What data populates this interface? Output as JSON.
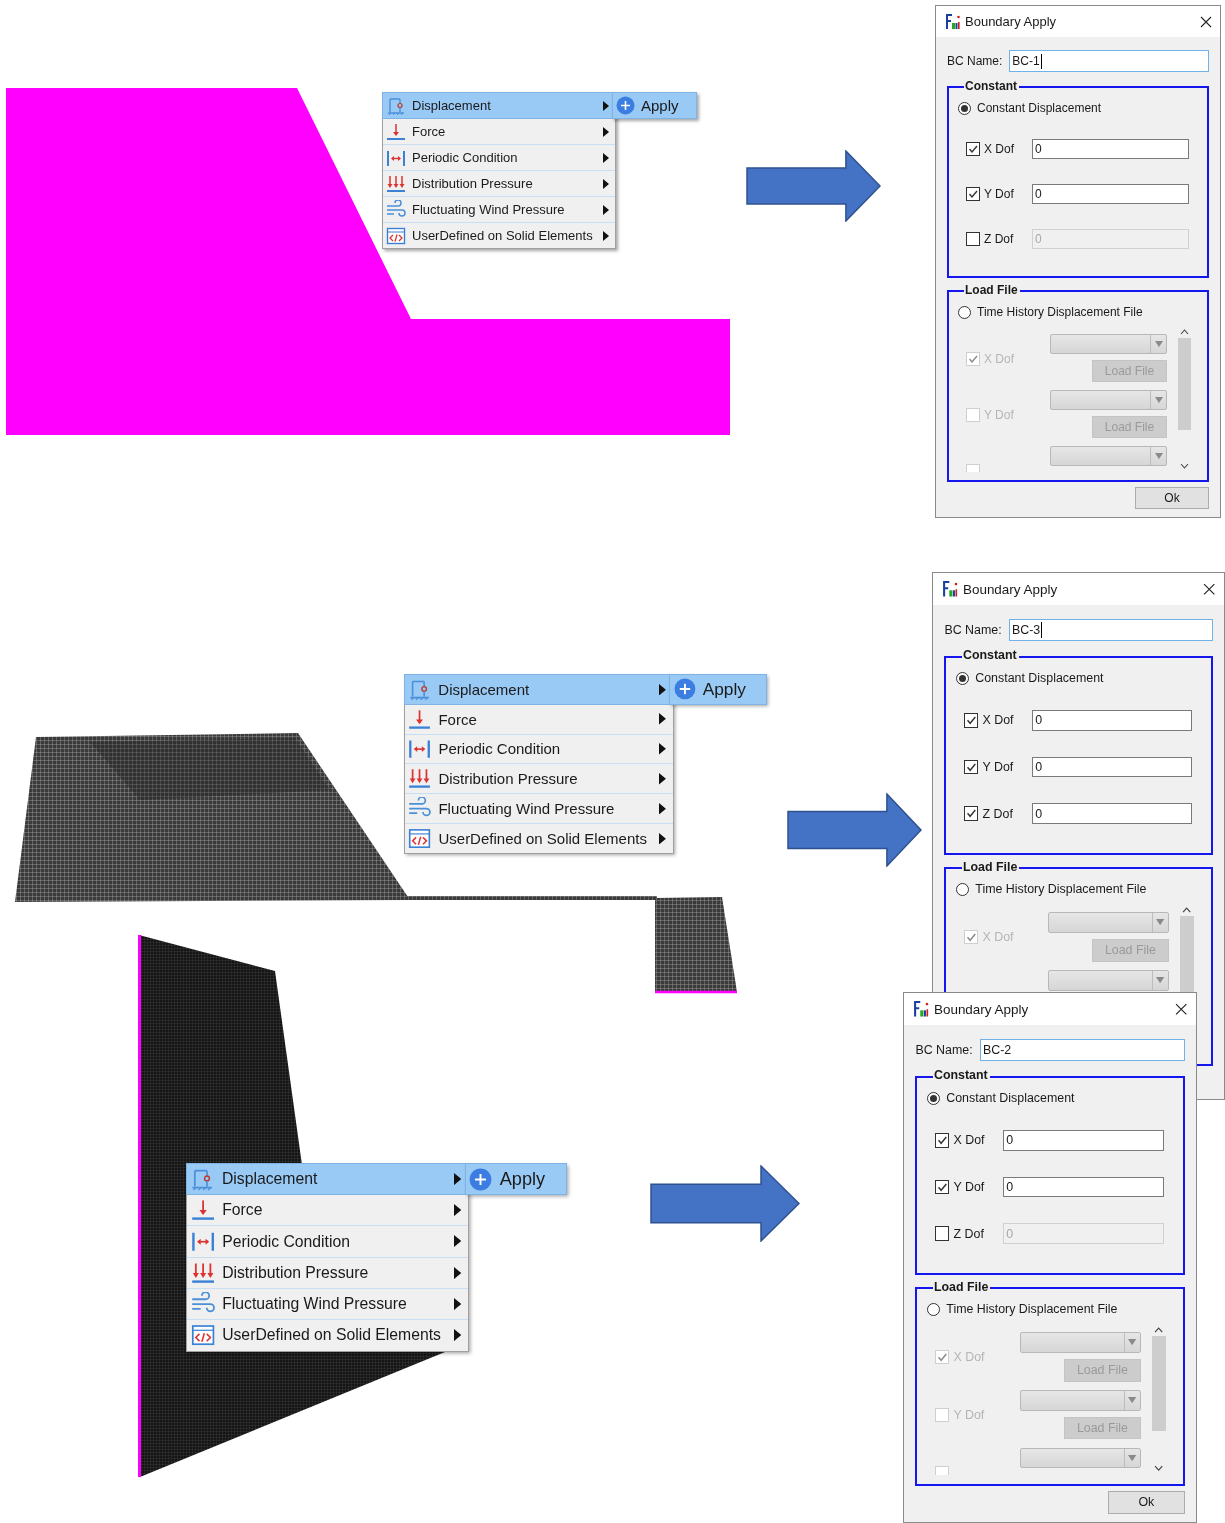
{
  "scenes": [
    {
      "model": {
        "kind": "flat"
      },
      "menu": {
        "items": [
          {
            "label": "Displacement",
            "selected": true
          },
          {
            "label": "Force",
            "selected": false
          },
          {
            "label": "Periodic Condition",
            "selected": false
          },
          {
            "label": "Distribution Pressure",
            "selected": false
          },
          {
            "label": "Fluctuating Wind Pressure",
            "selected": false
          },
          {
            "label": "UserDefined on Solid Elements",
            "selected": false
          }
        ],
        "submenu": {
          "label": "Apply"
        }
      },
      "dialog": {
        "title": "Boundary Apply",
        "name_label": "BC Name:",
        "name_value": "BC-1",
        "focused": true,
        "constant": {
          "title": "Constant",
          "option": {
            "label": "Constant Displacement",
            "selected": true
          },
          "dofs": [
            {
              "label": "X Dof",
              "checked": true,
              "value": "0"
            },
            {
              "label": "Y Dof",
              "checked": true,
              "value": "0"
            },
            {
              "label": "Z Dof",
              "checked": false,
              "value": "0"
            }
          ]
        },
        "load_file": {
          "title": "Load File",
          "option": {
            "label": "Time History Displacement File",
            "selected": false
          },
          "rows": [
            {
              "label": "X Dof",
              "checked": true,
              "button": "Load File"
            },
            {
              "label": "Y Dof",
              "checked": false,
              "button": "Load File"
            },
            {
              "checked": false
            }
          ]
        },
        "ok": "Ok"
      }
    },
    {
      "model": {
        "kind": "slope-mesh"
      },
      "menu": {
        "items": [
          {
            "label": "Displacement",
            "selected": true
          },
          {
            "label": "Force",
            "selected": false
          },
          {
            "label": "Periodic Condition",
            "selected": false
          },
          {
            "label": "Distribution Pressure",
            "selected": false
          },
          {
            "label": "Fluctuating Wind Pressure",
            "selected": false
          },
          {
            "label": "UserDefined on Solid Elements",
            "selected": false
          }
        ],
        "submenu": {
          "label": "Apply"
        }
      },
      "dialog": {
        "title": "Boundary Apply",
        "name_label": "BC Name:",
        "name_value": "BC-3",
        "focused": true,
        "constant": {
          "title": "Constant",
          "option": {
            "label": "Constant Displacement",
            "selected": true
          },
          "dofs": [
            {
              "label": "X Dof",
              "checked": true,
              "value": "0"
            },
            {
              "label": "Y Dof",
              "checked": true,
              "value": "0"
            },
            {
              "label": "Z Dof",
              "checked": true,
              "value": "0"
            }
          ]
        },
        "load_file": {
          "title": "Load File",
          "option": {
            "label": "Time History Displacement File",
            "selected": false
          },
          "rows": [
            {
              "kind": "dof",
              "label": "X Dof",
              "checked": true,
              "button": "Load File"
            },
            {
              "kind": "dropdown"
            }
          ]
        }
      }
    },
    {
      "model": {
        "kind": "wall-mesh"
      },
      "menu": {
        "items": [
          {
            "label": "Displacement",
            "selected": true
          },
          {
            "label": "Force",
            "selected": false
          },
          {
            "label": "Periodic Condition",
            "selected": false
          },
          {
            "label": "Distribution Pressure",
            "selected": false
          },
          {
            "label": "Fluctuating Wind Pressure",
            "selected": false
          },
          {
            "label": "UserDefined on Solid Elements",
            "selected": false
          }
        ],
        "submenu": {
          "label": "Apply"
        }
      },
      "dialog": {
        "title": "Boundary Apply",
        "name_label": "BC Name:",
        "name_value": "BC-2",
        "focused": false,
        "constant": {
          "title": "Constant",
          "option": {
            "label": "Constant Displacement",
            "selected": true
          },
          "dofs": [
            {
              "label": "X Dof",
              "checked": true,
              "value": "0"
            },
            {
              "label": "Y Dof",
              "checked": true,
              "value": "0"
            },
            {
              "label": "Z Dof",
              "checked": false,
              "value": "0"
            }
          ]
        },
        "load_file": {
          "title": "Load File",
          "option": {
            "label": "Time History Displacement File",
            "selected": false
          },
          "rows": [
            {
              "label": "X Dof",
              "checked": true,
              "button": "Load File"
            },
            {
              "label": "Y Dof",
              "checked": false,
              "button": "Load File"
            },
            {
              "checked": false
            }
          ]
        },
        "ok": "Ok"
      }
    }
  ]
}
